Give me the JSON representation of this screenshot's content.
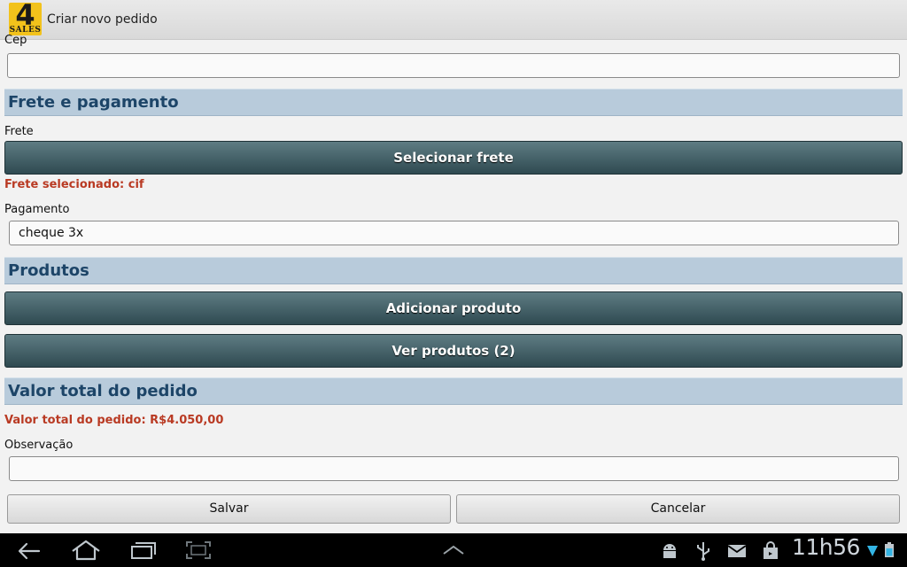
{
  "app": {
    "logo_number": "4",
    "logo_text": "SALES",
    "title": "Criar novo pedido"
  },
  "form": {
    "cep": {
      "label": "Cep",
      "value": ""
    },
    "sections": {
      "frete_pagamento": "Frete e pagamento",
      "produtos": "Produtos",
      "valor_total": "Valor total do pedido"
    },
    "frete": {
      "label": "Frete",
      "button": "Selecionar frete",
      "selected_text": "Frete selecionado: cif"
    },
    "pagamento": {
      "label": "Pagamento",
      "value": "cheque 3x"
    },
    "produtos": {
      "add_button": "Adicionar produto",
      "view_button": "Ver produtos (2)"
    },
    "total_text": "Valor total do pedido: R$4.050,00",
    "observacao": {
      "label": "Observação",
      "value": ""
    },
    "actions": {
      "save": "Salvar",
      "cancel": "Cancelar"
    }
  },
  "system_bar": {
    "clock": "11h56",
    "icons": [
      "back-icon",
      "home-icon",
      "recent-apps-icon",
      "screenshot-icon",
      "up-chevron-icon",
      "android-debug-icon",
      "usb-icon",
      "email-icon",
      "store-bag-icon",
      "wifi-icon",
      "battery-icon"
    ],
    "accent": "#33b5e5"
  }
}
